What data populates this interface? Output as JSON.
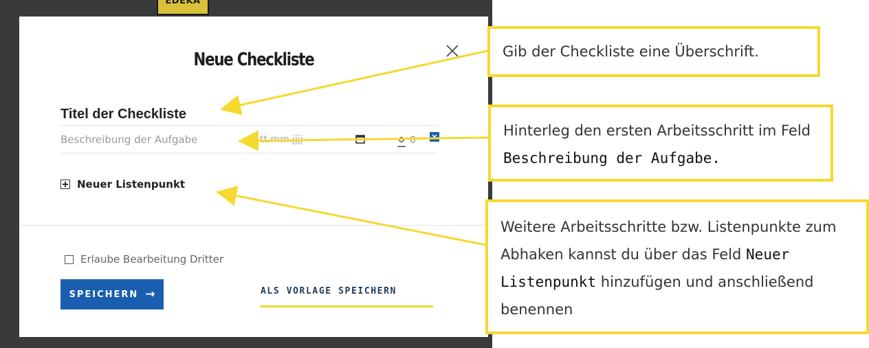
{
  "background": {
    "brand_label": "EDEKA"
  },
  "modal": {
    "title": "Neue Checkliste",
    "close_glyph": "×",
    "checklist_title": "Titel der Checkliste",
    "task": {
      "description_placeholder": "Beschreibung der Aufgabe",
      "date_placeholder": "tt.mm.jjjj",
      "assignee_count": "0"
    },
    "add_item_label": "Neuer Listenpunkt",
    "allow_third_party_label": "Erlaube Bearbeitung Dritter",
    "save_label": "SPEICHERN",
    "save_arrow": "→",
    "save_template_label": "ALS VORLAGE SPEICHERN"
  },
  "callouts": {
    "title_hint": "Gib der Checkliste eine Überschrift.",
    "description_hint_prefix": "Hinterleg den ersten Arbeitsschritt im Feld",
    "description_hint_emphasis": "Beschreibung der Aufgabe.",
    "list_hint_prefix": "Weitere Arbeitsschritte bzw. Listenpunkte zum Abhaken kannst du über das Feld",
    "list_hint_emphasis": "Neuer Listenpunkt",
    "list_hint_suffix": "hinzufügen und anschließend benennen"
  },
  "colors": {
    "accent_blue": "#1a5eb0",
    "callout_yellow": "#f5d930",
    "backdrop": "#3a3a3a"
  },
  "icons": [
    "close-icon",
    "calendar-icon",
    "user-icon",
    "close-badge-icon",
    "plus-square-icon",
    "checkbox",
    "arrow-right-icon"
  ]
}
